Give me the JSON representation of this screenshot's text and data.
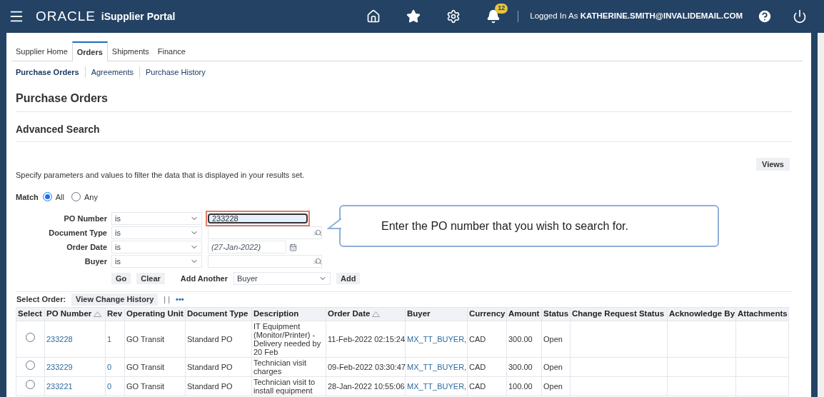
{
  "header": {
    "logo": "ORACLE",
    "product": "iSupplier Portal",
    "notification_count": "12",
    "logged_in_label": "Logged In As",
    "user": "KATHERINE.SMITH@INVALIDEMAIL.COM"
  },
  "tabs": [
    {
      "label": "Supplier Home",
      "selected": false
    },
    {
      "label": "Orders",
      "selected": true
    },
    {
      "label": "Shipments",
      "selected": false
    },
    {
      "label": "Finance",
      "selected": false
    }
  ],
  "subtabs": [
    {
      "label": "Purchase Orders",
      "selected": true
    },
    {
      "label": "Agreements",
      "selected": false
    },
    {
      "label": "Purchase History",
      "selected": false
    }
  ],
  "page_title": "Purchase Orders",
  "section_title": "Advanced Search",
  "views_button": "Views",
  "instructions": "Specify parameters and values to filter the data that is displayed in your results set.",
  "match": {
    "label": "Match",
    "options": [
      {
        "label": "All",
        "selected": true
      },
      {
        "label": "Any",
        "selected": false
      }
    ]
  },
  "criteria": [
    {
      "label": "PO Number",
      "operator": "is",
      "kind": "text",
      "value": "233228",
      "highlighted": true
    },
    {
      "label": "Document Type",
      "operator": "is",
      "kind": "lookup"
    },
    {
      "label": "Order Date",
      "operator": "is",
      "kind": "date",
      "placeholder": "(27-Jan-2022)"
    },
    {
      "label": "Buyer",
      "operator": "is",
      "kind": "lookup"
    }
  ],
  "go_button": "Go",
  "clear_button": "Clear",
  "add_another": {
    "label": "Add Another",
    "value": "Buyer",
    "button": "Add"
  },
  "callout": "Enter the PO number that you wish to search for.",
  "results": {
    "select_label": "Select Order:",
    "history_button": "View Change History",
    "separator": "| |",
    "more": "•••",
    "columns": [
      {
        "label": "Select"
      },
      {
        "label": "PO Number",
        "sorted": true
      },
      {
        "label": "Rev"
      },
      {
        "label": "Operating Unit"
      },
      {
        "label": "Document Type"
      },
      {
        "label": "Description"
      },
      {
        "label": "Order Date",
        "sorted": true
      },
      {
        "label": "Buyer"
      },
      {
        "label": "Currency"
      },
      {
        "label": "Amount"
      },
      {
        "label": "Status"
      },
      {
        "label": "Change Request Status"
      },
      {
        "label": "Acknowledge By"
      },
      {
        "label": "Attachments"
      }
    ],
    "rows": [
      {
        "selected": false,
        "po": "233228",
        "rev": "1",
        "unit": "GO Transit",
        "type": "Standard PO",
        "description": "IT Equipment (Monitor/Printer) - Delivery needed by 20 Feb",
        "date": "11-Feb-2022 02:15:24",
        "buyer": "MX_TT_BUYER,",
        "currency": "CAD",
        "amount": "300.00",
        "status": "Open"
      },
      {
        "selected": false,
        "po": "233229",
        "rev": "0",
        "unit": "GO Transit",
        "type": "Standard PO",
        "description": "Technician visit charges",
        "date": "09-Feb-2022 03:30:47",
        "buyer": "MX_TT_BUYER,",
        "currency": "CAD",
        "amount": "300.00",
        "status": "Open"
      },
      {
        "selected": false,
        "po": "233221",
        "rev": "0",
        "unit": "GO Transit",
        "type": "Standard PO",
        "description": "Technician visit to install equipment",
        "date": "28-Jan-2022 10:55:06",
        "buyer": "MX_TT_BUYER,",
        "currency": "CAD",
        "amount": "100.00",
        "status": "Open"
      }
    ]
  }
}
